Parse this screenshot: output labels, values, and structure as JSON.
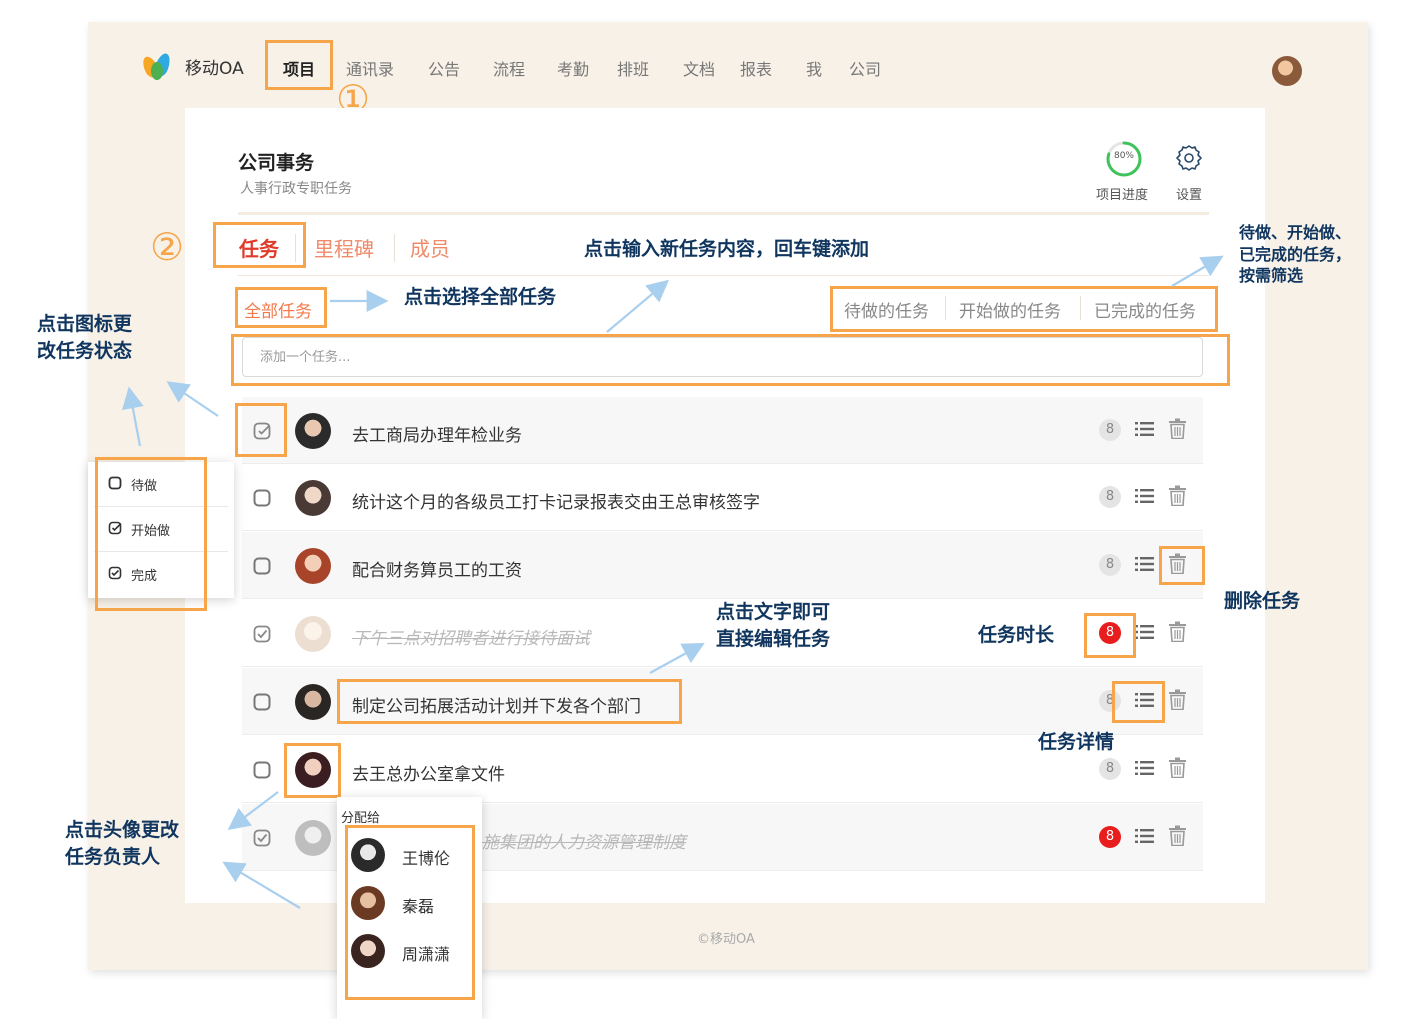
{
  "app": {
    "name": "移动OA"
  },
  "nav": [
    "项目",
    "通讯录",
    "公告",
    "流程",
    "考勤",
    "排班",
    "文档",
    "报表",
    "我",
    "公司"
  ],
  "step_markers": [
    "①",
    "②"
  ],
  "project": {
    "title": "公司事务",
    "subtitle": "人事行政专职任务",
    "progress": {
      "value_text": "80%",
      "fraction": 0.8,
      "label": "项目进度"
    },
    "settings_label": "设置"
  },
  "tabs": [
    "任务",
    "里程碑",
    "成员"
  ],
  "filters": {
    "all": "全部任务",
    "todo": "待做的任务",
    "started": "开始做的任务",
    "done": "已完成的任务"
  },
  "add_task": {
    "placeholder": "添加一个任务..."
  },
  "tasks": [
    {
      "text": "去工商局办理年检业务",
      "status": "started",
      "duration": "8",
      "alert": false
    },
    {
      "text": "统计这个月的各级员工打卡记录报表交由王总审核签字",
      "status": "todo",
      "duration": "8",
      "alert": false
    },
    {
      "text": "配合财务算员工的工资",
      "status": "todo",
      "duration": "8",
      "alert": false
    },
    {
      "text": "下午三点对招聘者进行接待面试",
      "status": "done",
      "duration": "8",
      "alert": true
    },
    {
      "text": "制定公司拓展活动计划并下发各个部门",
      "status": "todo",
      "duration": "8",
      "alert": false
    },
    {
      "text": "去王总办公室拿文件",
      "status": "todo",
      "duration": "8",
      "alert": false
    },
    {
      "text": "施集团的人力资源管理制度",
      "status": "done",
      "duration": "8",
      "alert": true
    }
  ],
  "status_menu": [
    "待做",
    "开始做",
    "完成"
  ],
  "assign_menu": {
    "title": "分配给",
    "people": [
      "王博伦",
      "秦磊",
      "周潇潇"
    ]
  },
  "annotations": {
    "add_task": "点击输入新任务内容，回车键添加",
    "select_all": "点击选择全部任务",
    "filter_line1": "待做、开始做、",
    "filter_line2": "已完成的任务，",
    "filter_line3": "按需筛选",
    "status_line1": "点击图标更",
    "status_line2": "改任务状态",
    "delete": "删除任务",
    "edit_line1": "点击文字即可",
    "edit_line2": "直接编辑任务",
    "duration": "任务时长",
    "detail": "任务详情",
    "assign_line1": "点击头像更改",
    "assign_line2": "任务负责人"
  },
  "footer": "©移动OA",
  "colors": {
    "highlight": "#f6a54a",
    "accent": "#e03b2a",
    "alert": "#e81d1d",
    "progress": "#3ec35a",
    "annotation": "#10355e"
  }
}
